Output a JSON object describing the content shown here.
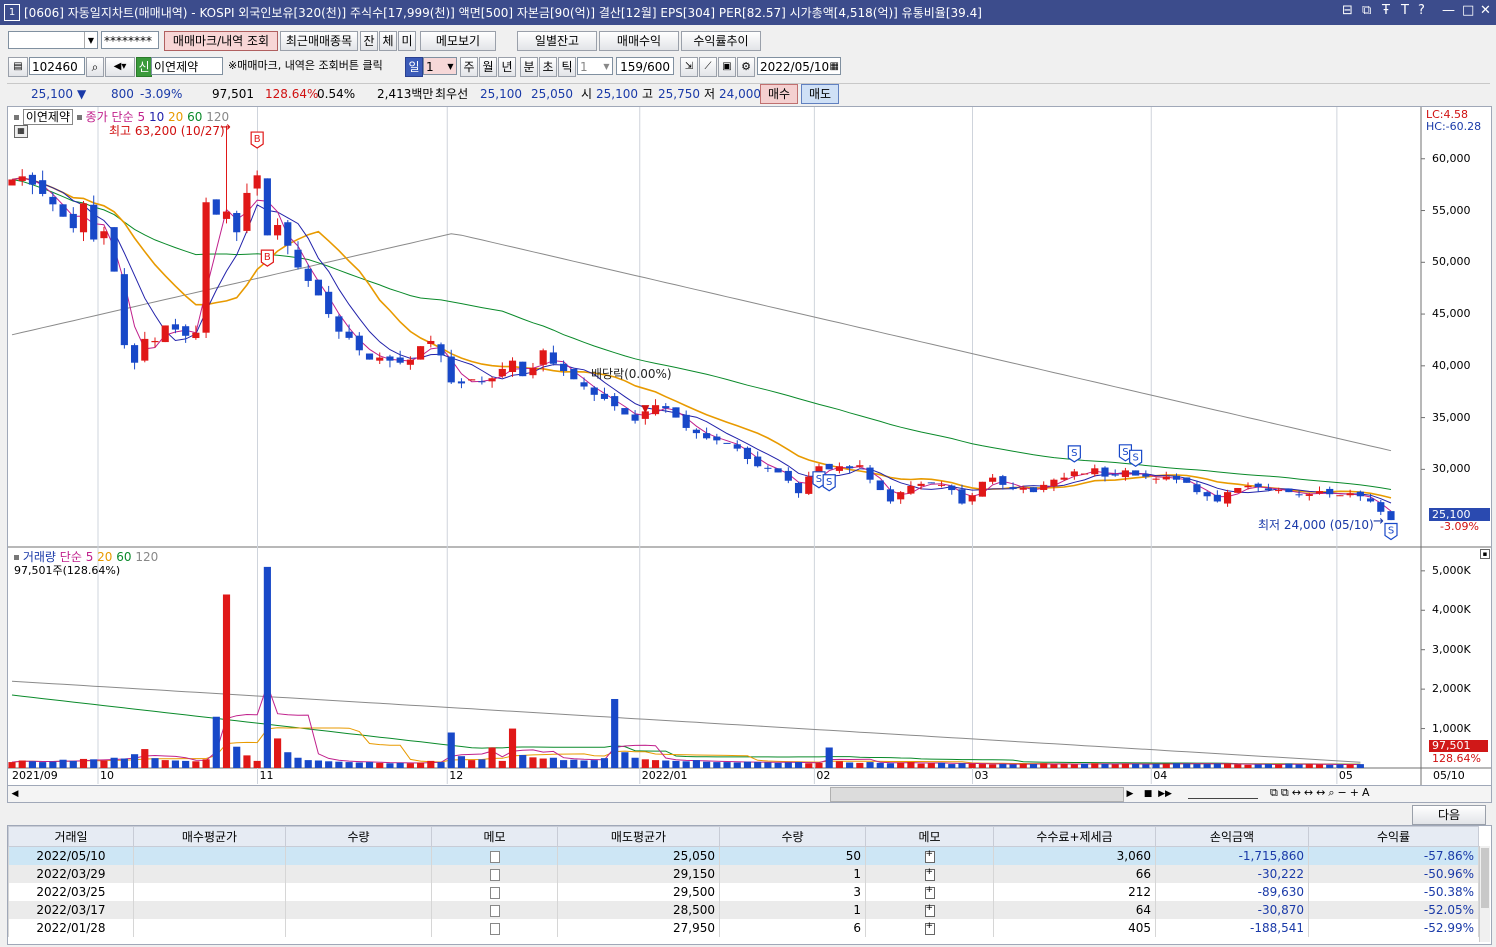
{
  "window": {
    "title": "[0606] 자동일지차트(매매내역) - KOSPI 외국인보유[320(천)] 주식수[17,999(천)] 액면[500] 자본금[90(억)] 결산[12월] EPS[304] PER[82.57] 시가총액[4,518(억)] 유통비율[39.4]",
    "app_icon": "1",
    "controls": [
      "⊟",
      "⧉",
      "Ŧ",
      "T",
      "?",
      "—",
      "□",
      "✕"
    ]
  },
  "toolbar1": {
    "account_value": "",
    "password_value": "********",
    "buttons": [
      "매매마크/내역 조회",
      "최근매매종목",
      "잔",
      "체",
      "미",
      "메모보기",
      "일별잔고",
      "매매수익",
      "수익률추이"
    ]
  },
  "toolbar2": {
    "code": "102460",
    "badge": "신",
    "name": "이연제약",
    "hint": "※매매마크, 내역은 조회버튼 클릭",
    "period_day": "일",
    "period_n": "1",
    "periods": [
      "주",
      "월",
      "년",
      "분",
      "초",
      "틱"
    ],
    "tick_n": "1",
    "count": "159/600",
    "date": "2022/05/10"
  },
  "quote": {
    "price": "25,100",
    "arrow": "▼",
    "change": "800",
    "change_pct": "-3.09%",
    "volume": "97,501",
    "volume_pct": "128.64%",
    "turnover_pct": "0.54%",
    "amount": "2,413백만",
    "best_label": "최우선",
    "best_ask": "25,100",
    "best_bid": "25,050",
    "open_label": "시",
    "open": "25,100",
    "high_label": "고",
    "high": "25,750",
    "low_label": "저",
    "low": "24,000",
    "buy_label": "매수",
    "sell_label": "매도"
  },
  "chart_data": [
    {
      "type": "candlestick",
      "title": "이연제약",
      "legend": [
        "종가 단순",
        "5",
        "10",
        "20",
        "60",
        "120"
      ],
      "ylim": [
        22500,
        65000
      ],
      "y_ticks": [
        "60,000",
        "55,000",
        "50,000",
        "45,000",
        "40,000",
        "35,000",
        "30,000"
      ],
      "x_ticks": [
        "2021/09",
        "10",
        "11",
        "12",
        "2022/01",
        "02",
        "03",
        "04",
        "05",
        "05/10"
      ],
      "right_top": [
        "LC:4.58",
        "HC:-60.28"
      ],
      "last_price_label": "25,100",
      "last_change_label": "-3.09%",
      "annotations": {
        "high": "최고 63,200 (10/27)",
        "low": "최저 24,000 (05/10)",
        "dividend": "배당락(0.00%)"
      },
      "close": [
        58000,
        58300,
        57500,
        56600,
        55600,
        54400,
        53300,
        55700,
        52200,
        53000,
        49100,
        42000,
        40300,
        42600,
        42400,
        43900,
        43500,
        42900,
        43200,
        55800,
        54600,
        54900,
        52900,
        56700,
        58400,
        52600,
        53600,
        51600,
        49500,
        48200,
        46800,
        45000,
        43300,
        42700,
        41500,
        40600,
        40800,
        40500,
        40300,
        40600,
        41900,
        42400,
        41000,
        38400,
        38300,
        38700,
        38500,
        38800,
        39700,
        40500,
        39000,
        39800,
        41500,
        40200,
        39500,
        38700,
        38000,
        37200,
        36800,
        36100,
        35300,
        34700,
        35600,
        36200,
        35900,
        35000,
        34000,
        33500,
        33000,
        32800,
        32500,
        32000,
        31000,
        30300,
        30100,
        29700,
        28900,
        27700,
        29300,
        30300,
        30000,
        30300,
        30100,
        30400,
        29000,
        28000,
        26900,
        27800,
        28400,
        28600,
        28700,
        28500,
        28000,
        26700,
        27500,
        28800,
        29200,
        28500,
        28100,
        28200,
        27800,
        28500,
        29000,
        29200,
        29800,
        29600,
        30100,
        29300,
        29400,
        29900,
        29400,
        29300,
        29100,
        29300,
        29000,
        28700,
        27800,
        27400,
        26900,
        27800,
        28200,
        28400,
        28300,
        28000,
        28000,
        27800,
        27500,
        27600,
        27900,
        27600,
        27500,
        27700,
        27400,
        26900,
        25900,
        25100
      ],
      "ma": {
        "5": {
          "start": [
            58000,
            40300
          ],
          "end": [
            26500
          ]
        },
        "20": {
          "start": 56000,
          "end": 27200
        },
        "60": {
          "start": 58000,
          "end": 28000
        },
        "120": {
          "start": 43000,
          "peak": 52800,
          "end": 31800
        }
      }
    },
    {
      "type": "bar",
      "title": "거래량",
      "legend": [
        "단순",
        "5",
        "20",
        "60",
        "120"
      ],
      "summary": "97,501주(128.64%)",
      "ylim": [
        0,
        5300
      ],
      "unit": "K",
      "y_ticks": [
        "5,000K",
        "4,000K",
        "3,000K",
        "2,000K",
        "1,000K"
      ],
      "last_volume_label": "97,501",
      "last_volume_pct_label": "128.64%",
      "values_k": [
        150,
        190,
        170,
        150,
        160,
        210,
        180,
        230,
        220,
        190,
        260,
        240,
        350,
        480,
        250,
        200,
        190,
        180,
        170,
        220,
        1300,
        4400,
        540,
        320,
        180,
        5100,
        750,
        400,
        260,
        200,
        190,
        170,
        160,
        150,
        140,
        150,
        130,
        120,
        130,
        120,
        140,
        180,
        150,
        900,
        300,
        200,
        220,
        520,
        180,
        1000,
        330,
        270,
        240,
        260,
        200,
        210,
        190,
        200,
        250,
        1750,
        400,
        260,
        220,
        200,
        190,
        180,
        170,
        200,
        160,
        150,
        150,
        140,
        160,
        150,
        140,
        130,
        140,
        150,
        120,
        130,
        520,
        170,
        140,
        130,
        150,
        130,
        120,
        140,
        150,
        110,
        120,
        130,
        100,
        120,
        110,
        100,
        90,
        100,
        90,
        110,
        100,
        120,
        90,
        100,
        90,
        110,
        120,
        100,
        90,
        110,
        100,
        90,
        100,
        110,
        120,
        110,
        100,
        100,
        110,
        110,
        90,
        80,
        90,
        100,
        90,
        110,
        90,
        100,
        90,
        80,
        90,
        90,
        98
      ]
    }
  ],
  "scroll": {
    "next_label": "다음"
  },
  "table": {
    "headers": [
      "거래일",
      "매수평균가",
      "수량",
      "메모",
      "매도평균가",
      "수량",
      "메모",
      "수수료+제세금",
      "손익금액",
      "수익률"
    ],
    "rows": [
      {
        "date": "2022/05/10",
        "buy_avg": "",
        "buy_qty": "",
        "sell_avg": "25,050",
        "sell_qty": "50",
        "fee": "3,060",
        "pnl": "-1,715,860",
        "ret": "-57.86%"
      },
      {
        "date": "2022/03/29",
        "buy_avg": "",
        "buy_qty": "",
        "sell_avg": "29,150",
        "sell_qty": "1",
        "fee": "66",
        "pnl": "-30,222",
        "ret": "-50.96%"
      },
      {
        "date": "2022/03/25",
        "buy_avg": "",
        "buy_qty": "",
        "sell_avg": "29,500",
        "sell_qty": "3",
        "fee": "212",
        "pnl": "-89,630",
        "ret": "-50.38%"
      },
      {
        "date": "2022/03/17",
        "buy_avg": "",
        "buy_qty": "",
        "sell_avg": "28,500",
        "sell_qty": "1",
        "fee": "64",
        "pnl": "-30,870",
        "ret": "-52.05%"
      },
      {
        "date": "2022/01/28",
        "buy_avg": "",
        "buy_qty": "",
        "sell_avg": "27,950",
        "sell_qty": "6",
        "fee": "405",
        "pnl": "-188,541",
        "ret": "-52.99%"
      }
    ]
  }
}
